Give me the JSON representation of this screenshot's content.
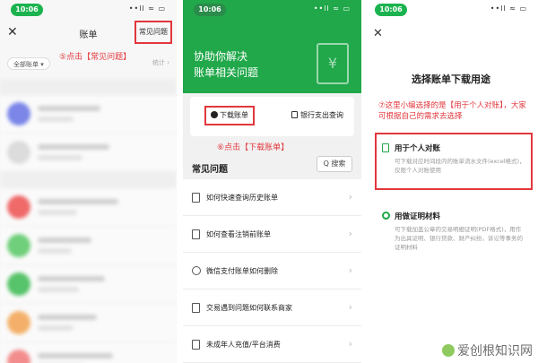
{
  "colors": {
    "accent_green": "#20a84a",
    "annotation_red": "#e2373d"
  },
  "panel1": {
    "time": "10:06",
    "status_icons": "••ll ≈ ▭",
    "close_icon": "close-icon",
    "title": "账单",
    "faq_button": "常见问题",
    "step_note": "⑤点击【常见问题】",
    "filter_label": "全部账单 ▾",
    "stats_label": "统计 ›"
  },
  "panel2": {
    "time": "10:06",
    "status_icons": "••ll ≈ ▭",
    "headline_line1": "协助你解决",
    "headline_line2": "账单相关问题",
    "doc_symbol": "¥",
    "download_button": "下载账单",
    "bank_query": "银行支出查询",
    "step_note": "⑥点击【下载账单】",
    "faq_title": "常见问题",
    "search_label": "Q 搜索",
    "questions": [
      "如何快速查询历史账单",
      "如何查看注销前账单",
      "微信支付账单如何删除",
      "交易遇到问题如何联系商家",
      "未成年人充值/平台消费"
    ]
  },
  "panel3": {
    "time": "10:06",
    "status_icons": "••ll ≈ ▭",
    "title": "选择账单下载用途",
    "step_note": "⑦这里小编选择的是【用于个人对账】，大家可根据自己的需求去选择",
    "option1_title": "用于个人对账",
    "option1_desc": "可下载对应时间段内的账单流水文件(excel格式)，仅限个人对账使用",
    "option2_title": "用做证明材料",
    "option2_desc": "可下载加盖公章的交易明细证明(PDF格式)，用作为出具证明、银行贷款、财产纠纷，诉讼等事务的证明材料"
  },
  "watermark": "爱创根知识网"
}
